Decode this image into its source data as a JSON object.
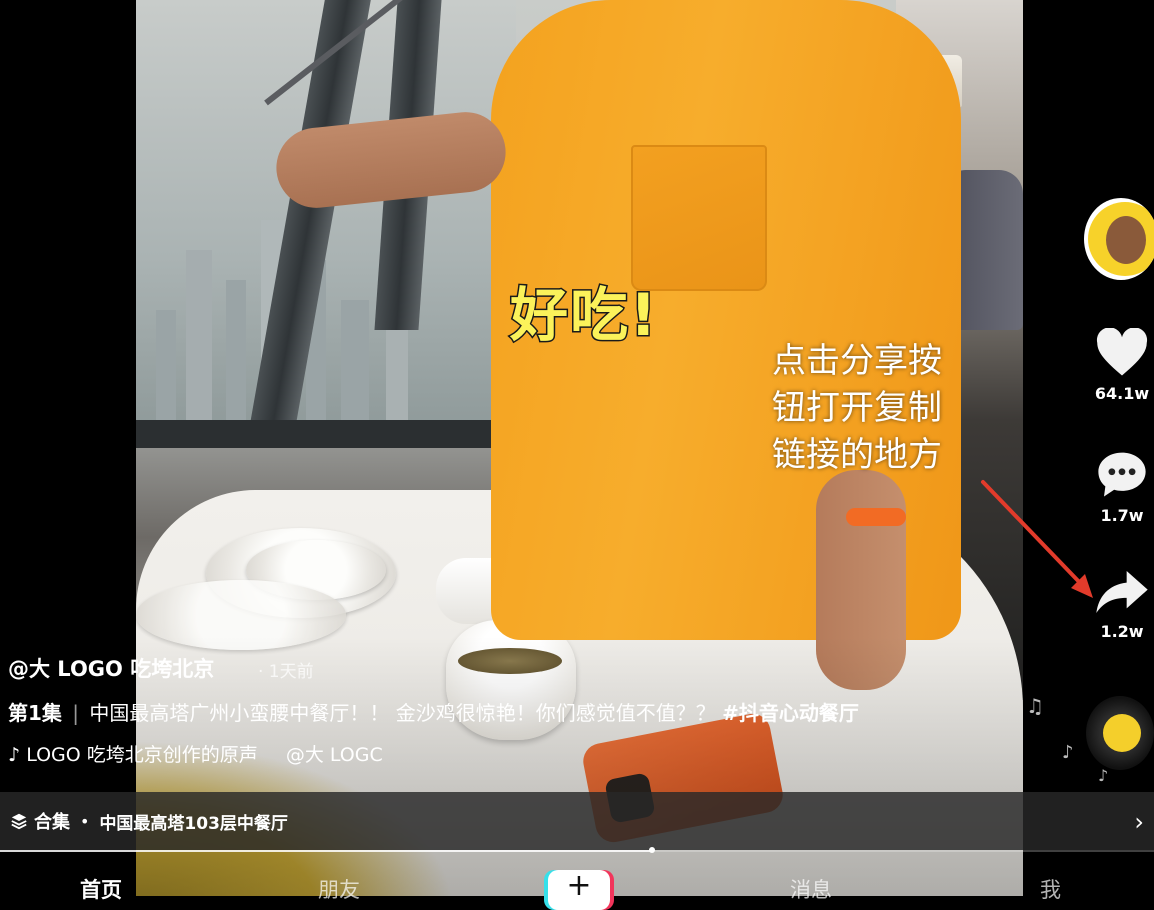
{
  "video": {
    "caption_yummy": "好吃!",
    "caption_note_lines": [
      "点击分享按",
      "钮打开复制",
      "链接的地方"
    ]
  },
  "rail": {
    "likes": "64.1w",
    "comments": "1.7w",
    "shares": "1.2w",
    "icons": {
      "like": "heart-icon",
      "comment": "comment-icon",
      "share": "share-icon",
      "music": "music-disc-icon"
    }
  },
  "info": {
    "author": "@大 LOGO 吃垮北京",
    "time": "· 1天前",
    "episode": "第1集",
    "separator": "|",
    "description": "中国最高塔广州小蛮腰中餐厅！！ 金沙鸡很惊艳！你们感觉值不值？？",
    "hashtag": "#抖音心动餐厅",
    "sound_text": "LOGO 吃垮北京创作的原声",
    "sound_mention": "@大 LOGC"
  },
  "collection": {
    "label": "合集",
    "dot": "•",
    "title": "中国最高塔103层中餐厅",
    "chevron": "›"
  },
  "playback": {
    "progress": 0.565
  },
  "tabs": {
    "home": "首页",
    "friends": "朋友",
    "plus": "+",
    "messages": "消息",
    "me": "我"
  },
  "colors": {
    "shirt": "#f7ad2c",
    "caption_yellow": "#fbf25a",
    "arrow_red": "#e23b2b",
    "phone_orange": "#f0733a"
  }
}
